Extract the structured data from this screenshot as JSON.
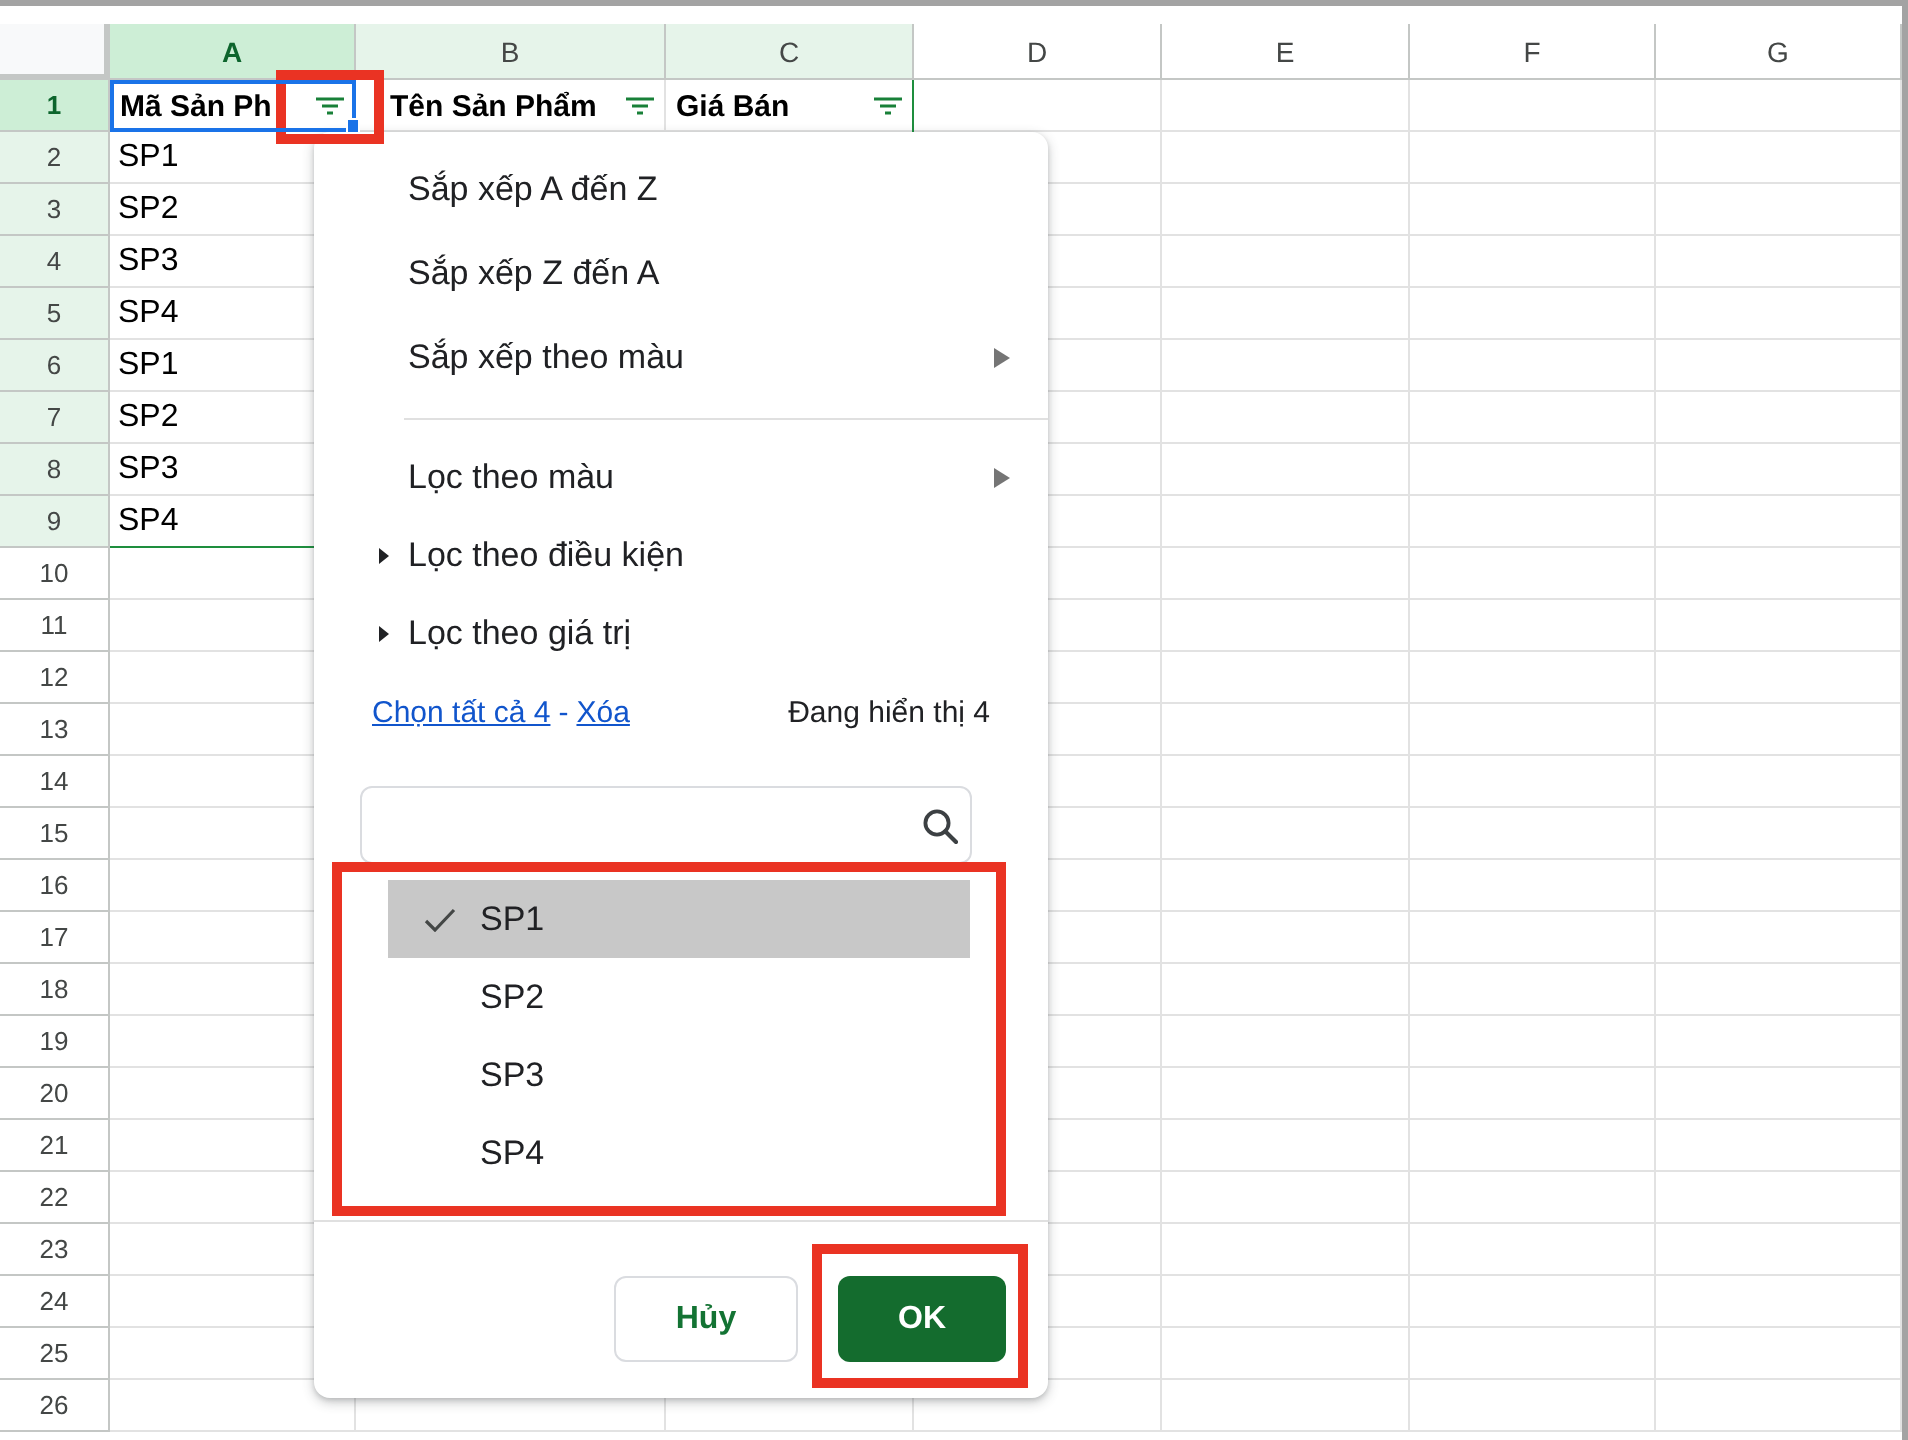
{
  "sheet": {
    "columns": [
      {
        "label": "A",
        "selected": true,
        "active": true
      },
      {
        "label": "B",
        "selected": true,
        "active": false
      },
      {
        "label": "C",
        "selected": true,
        "active": false
      },
      {
        "label": "D",
        "selected": false,
        "active": false
      },
      {
        "label": "E",
        "selected": false,
        "active": false
      },
      {
        "label": "F",
        "selected": false,
        "active": false
      },
      {
        "label": "G",
        "selected": false,
        "active": false
      }
    ],
    "rows": [
      {
        "number": "1",
        "selected": true,
        "active": true,
        "cells": [
          {
            "text": "Mã Sản Ph",
            "active": true,
            "filter": true
          },
          {
            "text": "Tên Sản Phẩm",
            "active": false,
            "filter": true
          },
          {
            "text": "Giá Bán",
            "active": false,
            "filter": true
          }
        ]
      },
      {
        "number": "2",
        "selected": true,
        "active": false,
        "cells": [
          {
            "text": "SP1",
            "active": false,
            "filter": false
          }
        ]
      },
      {
        "number": "3",
        "selected": true,
        "active": false,
        "cells": [
          {
            "text": "SP2",
            "active": false,
            "filter": false
          }
        ]
      },
      {
        "number": "4",
        "selected": true,
        "active": false,
        "cells": [
          {
            "text": "SP3",
            "active": false,
            "filter": false
          }
        ]
      },
      {
        "number": "5",
        "selected": true,
        "active": false,
        "cells": [
          {
            "text": "SP4",
            "active": false,
            "filter": false
          }
        ]
      },
      {
        "number": "6",
        "selected": true,
        "active": false,
        "cells": [
          {
            "text": "SP1",
            "active": false,
            "filter": false
          }
        ]
      },
      {
        "number": "7",
        "selected": true,
        "active": false,
        "cells": [
          {
            "text": "SP2",
            "active": false,
            "filter": false
          }
        ]
      },
      {
        "number": "8",
        "selected": true,
        "active": false,
        "cells": [
          {
            "text": "SP3",
            "active": false,
            "filter": false
          }
        ]
      },
      {
        "number": "9",
        "selected": true,
        "active": false,
        "cells": [
          {
            "text": "SP4",
            "active": false,
            "filter": false
          }
        ]
      },
      {
        "number": "10",
        "selected": false,
        "active": false
      },
      {
        "number": "11",
        "selected": false,
        "active": false
      },
      {
        "number": "12",
        "selected": false,
        "active": false
      },
      {
        "number": "13",
        "selected": false,
        "active": false
      },
      {
        "number": "14",
        "selected": false,
        "active": false
      },
      {
        "number": "15",
        "selected": false,
        "active": false
      },
      {
        "number": "16",
        "selected": false,
        "active": false
      },
      {
        "number": "17",
        "selected": false,
        "active": false
      },
      {
        "number": "18",
        "selected": false,
        "active": false
      },
      {
        "number": "19",
        "selected": false,
        "active": false
      },
      {
        "number": "20",
        "selected": false,
        "active": false
      },
      {
        "number": "21",
        "selected": false,
        "active": false
      },
      {
        "number": "22",
        "selected": false,
        "active": false
      },
      {
        "number": "23",
        "selected": false,
        "active": false
      },
      {
        "number": "24",
        "selected": false,
        "active": false
      },
      {
        "number": "25",
        "selected": false,
        "active": false
      },
      {
        "number": "26",
        "selected": false,
        "active": false
      }
    ]
  },
  "filter_menu": {
    "items": [
      {
        "kind": "action",
        "label": "Sắp xếp A đến Z"
      },
      {
        "kind": "action",
        "label": "Sắp xếp Z đến A"
      },
      {
        "kind": "submenu",
        "label": "Sắp xếp theo màu"
      },
      {
        "kind": "divider"
      },
      {
        "kind": "submenu",
        "label": "Lọc theo màu"
      },
      {
        "kind": "section",
        "label": "Lọc theo điều kiện",
        "expanded": false
      },
      {
        "kind": "section",
        "label": "Lọc theo giá trị",
        "expanded": false
      }
    ],
    "select_all_link": "Chọn tất cả 4",
    "link_separator": "-",
    "clear_link": "Xóa",
    "visible_count": "Đang hiển thị 4",
    "values": [
      {
        "label": "SP1",
        "checked": true,
        "selected": true
      },
      {
        "label": "SP2",
        "checked": false,
        "selected": false
      },
      {
        "label": "SP3",
        "checked": false,
        "selected": false
      },
      {
        "label": "SP4",
        "checked": false,
        "selected": false
      }
    ],
    "buttons": [
      {
        "kind": "secondary",
        "label": "Hủy"
      },
      {
        "kind": "primary",
        "label": "OK"
      }
    ]
  }
}
